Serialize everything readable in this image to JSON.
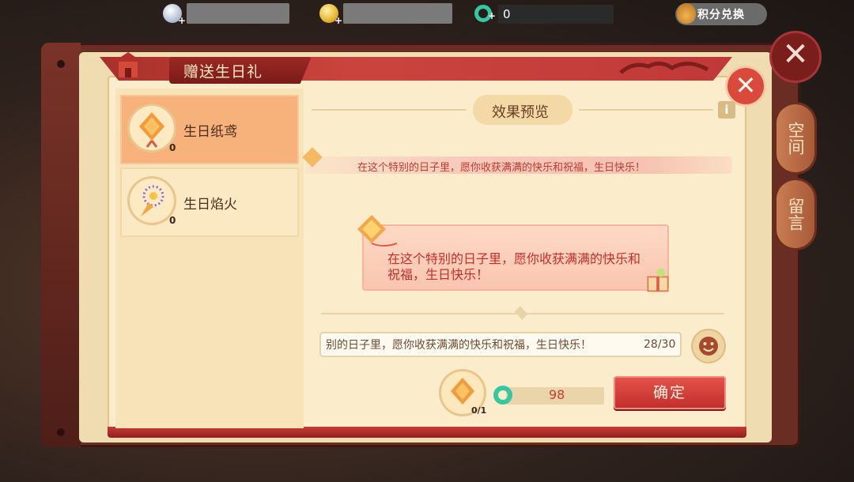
{
  "top_bar": {
    "silver": {
      "icon": "silver-coin-icon",
      "value": ""
    },
    "gold": {
      "icon": "gold-coin-icon",
      "value": ""
    },
    "jade": {
      "icon": "jade-icon",
      "value": "0"
    },
    "exchange_label": "积分兑换"
  },
  "dialog": {
    "title": "赠送生日礼",
    "preview_title": "效果预览",
    "info_label": "i",
    "gifts": [
      {
        "name": "生日纸鸢",
        "count": "0",
        "icon": "kite-icon",
        "selected": true
      },
      {
        "name": "生日焰火",
        "count": "0",
        "icon": "fireworks-icon",
        "selected": false
      }
    ],
    "marquee_text": "在这个特别的日子里，愿你收获满满的快乐和祝福，生日快乐！",
    "bubble_text": "在这个特别的日子里，愿你收获满满的快乐和祝福，生日快乐！",
    "message": {
      "value": "别的日子里，愿你收获满满的快乐和祝福，生日快乐！",
      "count": "28/30"
    },
    "cost": {
      "gift_count": "0/1",
      "price": "98",
      "currency_icon": "jade-icon"
    },
    "confirm_label": "确定"
  },
  "side_tabs": [
    "空间",
    "留言"
  ],
  "colors": {
    "accent_red": "#c0393a",
    "panel_bg": "#fbeccb",
    "selected_item": "#f6b27a"
  }
}
